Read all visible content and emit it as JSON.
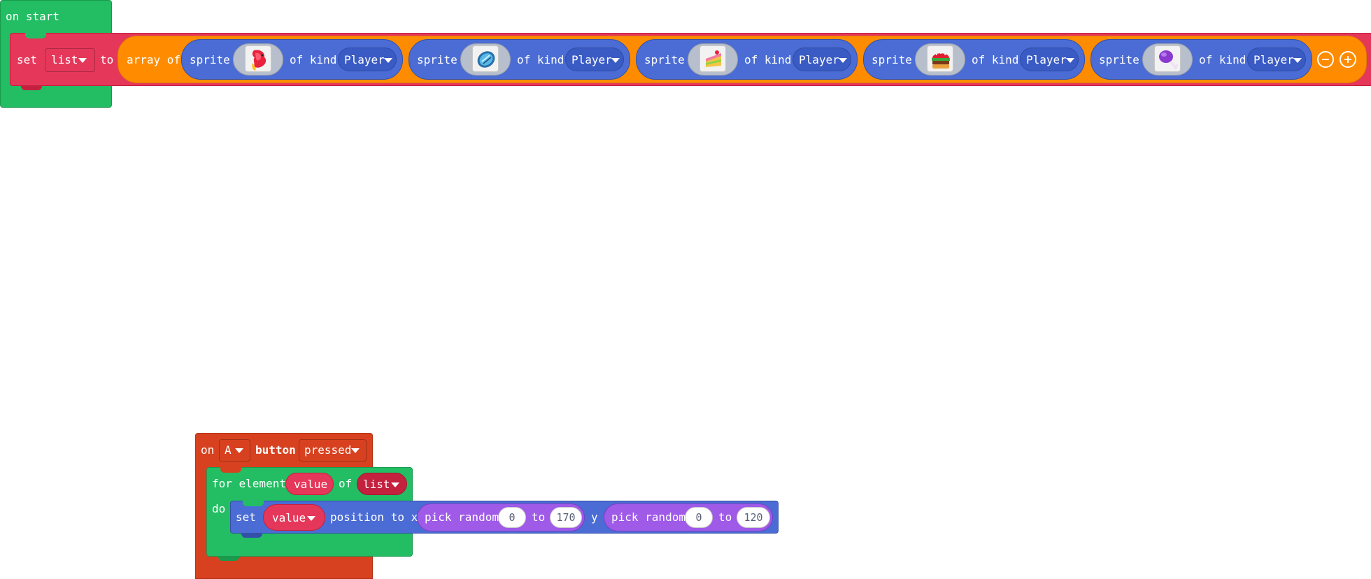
{
  "on_start": {
    "hat_label": "on start",
    "set_label": "set",
    "variable": "list",
    "to_label": "to",
    "array_label": "array of",
    "sprites": [
      {
        "label": "sprite",
        "image": "red-phoenix-sprite",
        "kind_label": "of kind",
        "kind": "Player"
      },
      {
        "label": "sprite",
        "image": "blue-gem-sprite",
        "kind_label": "of kind",
        "kind": "Player"
      },
      {
        "label": "sprite",
        "image": "cake-slice-sprite",
        "kind_label": "of kind",
        "kind": "Player"
      },
      {
        "label": "sprite",
        "image": "burger-sprite",
        "kind_label": "of kind",
        "kind": "Player"
      },
      {
        "label": "sprite",
        "image": "purple-drumstick-sprite",
        "kind_label": "of kind",
        "kind": "Player"
      }
    ]
  },
  "on_button": {
    "on_label": "on",
    "button_name": "A",
    "button_label": "button",
    "event": "pressed",
    "for_label": "for element",
    "element_var": "value",
    "of_label": "of",
    "list_var": "list",
    "do_label": "do",
    "set_label": "set",
    "sprite_var": "value",
    "position_label": "position to x",
    "x_pick_label": "pick random",
    "x_min": "0",
    "x_to_label": "to",
    "x_max": "170",
    "y_label": "y",
    "y_pick_label": "pick random",
    "y_min": "0",
    "y_to_label": "to",
    "y_max": "120"
  },
  "colors": {
    "event_green": "#23bd63",
    "variables_red": "#e5375a",
    "array_orange": "#ff8c00",
    "sprites_blue": "#4a6cd4",
    "controller_red": "#d7411f",
    "math_purple": "#9f5ae8"
  }
}
